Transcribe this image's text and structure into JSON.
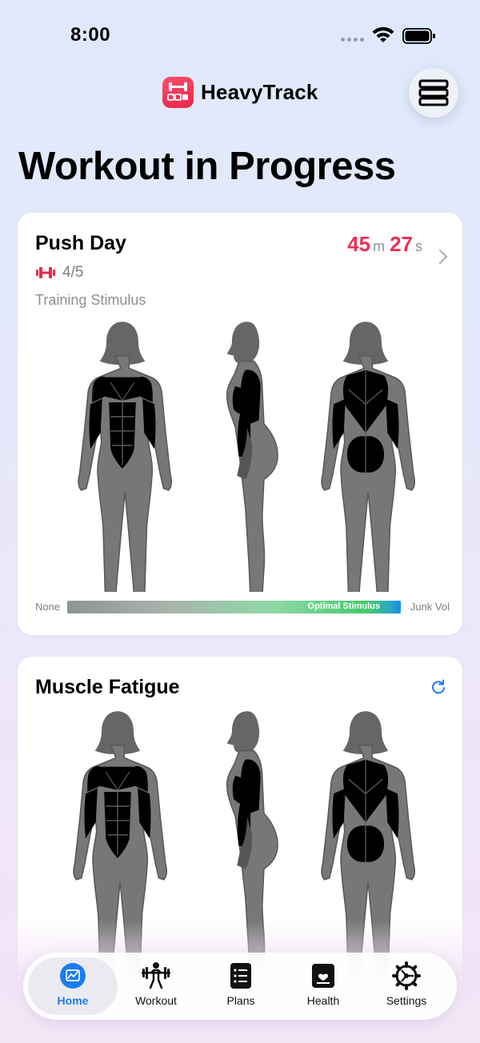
{
  "status_bar": {
    "time": "8:00"
  },
  "header": {
    "app_name": "HeavyTrack",
    "logo_icon": "app-logo-icon",
    "menu_icon": "stack-menu-icon"
  },
  "page": {
    "title": "Workout in Progress"
  },
  "workout_card": {
    "title": "Push Day",
    "timer": {
      "minutes": "45",
      "minutes_unit": "m",
      "seconds": "27",
      "seconds_unit": "s"
    },
    "sets": "4/5",
    "section_label": "Training Stimulus",
    "legend": {
      "min_label": "None",
      "marker_label": "Optimal Stimulus",
      "max_label": "Junk Vol"
    },
    "highlight_color": "#4cc15a"
  },
  "fatigue_card": {
    "title": "Muscle Fatigue",
    "highlight_colors": [
      "#e8437f",
      "#d43fc4",
      "#c45a86"
    ]
  },
  "colors": {
    "accent": "#1a7cf0",
    "timer": "#ee2f55",
    "brand": "#e8274b"
  },
  "tab_bar": {
    "tabs": [
      {
        "label": "Home",
        "icon": "chart-icon",
        "active": true
      },
      {
        "label": "Workout",
        "icon": "barbell-lifter-icon",
        "active": false
      },
      {
        "label": "Plans",
        "icon": "list-icon",
        "active": false
      },
      {
        "label": "Health",
        "icon": "heart-card-icon",
        "active": false
      },
      {
        "label": "Settings",
        "icon": "gear-icon",
        "active": false
      }
    ]
  }
}
